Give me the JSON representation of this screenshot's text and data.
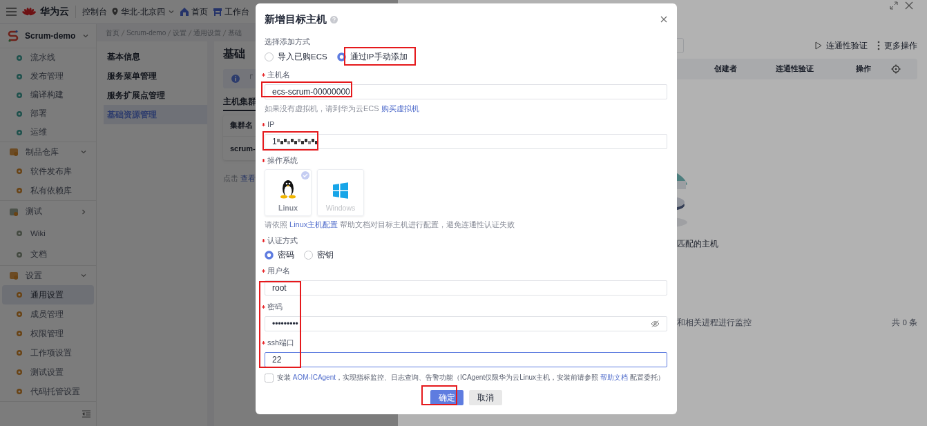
{
  "topbar": {
    "brand": "华为云",
    "console": "控制台",
    "region": "华北-北京四",
    "links": [
      {
        "label": "首页",
        "kind": "home"
      },
      {
        "label": "工作台",
        "kind": "desk"
      }
    ]
  },
  "project": {
    "name": "Scrum-demo",
    "expanded": true
  },
  "sidebar": {
    "sections": [
      {
        "items": [
          {
            "label": "流水线",
            "selected": false
          },
          {
            "label": "发布管理",
            "selected": false
          },
          {
            "label": "编译构建",
            "selected": false
          },
          {
            "label": "部署",
            "selected": false
          },
          {
            "label": "运维",
            "selected": false
          }
        ]
      },
      {
        "items": [
          {
            "label": "制品仓库",
            "selected": false,
            "expanded": true,
            "children": [
              {
                "label": "软件发布库",
                "selected": false
              },
              {
                "label": "私有依赖库",
                "selected": false
              }
            ]
          }
        ]
      },
      {
        "items": [
          {
            "label": "测试",
            "selected": false,
            "expanded": false
          },
          {
            "label": "Wiki",
            "selected": false
          },
          {
            "label": "文档",
            "selected": false
          }
        ]
      },
      {
        "items": [
          {
            "label": "设置",
            "selected": false,
            "expanded": true,
            "children": [
              {
                "label": "通用设置",
                "selected": true
              },
              {
                "label": "成员管理",
                "selected": false
              },
              {
                "label": "权限管理",
                "selected": false
              },
              {
                "label": "工作项设置",
                "selected": false
              },
              {
                "label": "测试设置",
                "selected": false
              },
              {
                "label": "代码托管设置",
                "selected": false
              }
            ]
          }
        ]
      }
    ]
  },
  "breadcrumb": [
    "首页",
    "Scrum-demo",
    "设置",
    "通用设置",
    "基础"
  ],
  "subnav": {
    "items": [
      {
        "label": "基本信息",
        "selected": false
      },
      {
        "label": "服务菜单管理",
        "selected": false
      },
      {
        "label": "服务扩展点管理",
        "selected": false
      },
      {
        "label": "基础资源管理",
        "selected": true
      }
    ]
  },
  "content": {
    "title": "基础",
    "banner": "「",
    "tabs": [
      {
        "label": "主机集群",
        "selected": true
      }
    ],
    "table": {
      "columns": [
        "集群名"
      ],
      "rows": [
        [
          "scrum-"
        ]
      ]
    },
    "hint": {
      "text": "点击",
      "link": "查看"
    }
  },
  "drawer": {
    "actions": [
      {
        "label": "连通性验证",
        "kind": "play"
      },
      {
        "label": "更多操作",
        "kind": "more"
      }
    ],
    "table": {
      "columns": [
        "创建者",
        "连通性验证",
        "操作"
      ]
    },
    "empty_text": "匹配的主机",
    "footer_text": "和相关进程进行监控",
    "total": "共 0 条"
  },
  "modal": {
    "title": "新增目标主机",
    "add_method": {
      "label": "选择添加方式",
      "options": [
        {
          "label": "导入已购ECS",
          "selected": false,
          "highlighted": false
        },
        {
          "label": "通过IP手动添加",
          "selected": true,
          "highlighted": true
        }
      ]
    },
    "fields": [
      {
        "kind": "text",
        "label": "主机名",
        "required": true,
        "value": "ecs-scrum-00000000",
        "highlighted": true,
        "help": [
          {
            "text": "如果没有虚拟机，请到华为云ECS "
          },
          {
            "link": "购买虚拟机"
          }
        ]
      },
      {
        "kind": "masked",
        "label": "IP",
        "required": true,
        "value": "1",
        "highlighted": true
      },
      {
        "kind": "os",
        "label": "操作系统",
        "required": true,
        "options": [
          {
            "label": "Linux",
            "selected": true
          },
          {
            "label": "Windows",
            "selected": false
          }
        ],
        "help": [
          {
            "text": "请依照 "
          },
          {
            "link": "Linux主机配置"
          },
          {
            "text": " 帮助文档对目标主机进行配置，避免连通性认证失败"
          }
        ]
      },
      {
        "kind": "radio",
        "label": "认证方式",
        "required": true,
        "options": [
          {
            "label": "密码",
            "selected": true
          },
          {
            "label": "密钥",
            "selected": false
          }
        ]
      },
      {
        "kind": "group",
        "highlighted": true,
        "children": [
          {
            "kind": "text",
            "label": "用户名",
            "required": true,
            "value": "root"
          },
          {
            "kind": "password",
            "label": "密码",
            "required": true,
            "value": "•••••••••"
          },
          {
            "kind": "text",
            "label": "ssh端口",
            "required": true,
            "value": "22",
            "focused": true
          }
        ]
      }
    ],
    "agent": {
      "checked": false,
      "parts": [
        {
          "text": "安装 "
        },
        {
          "link": "AOM-ICAgent"
        },
        {
          "text": "，实现指标监控、日志查询、告警功能（ICAgent仅限华为云Linux主机，安装前请参照 "
        },
        {
          "link": "帮助文档"
        },
        {
          "text": " 配置委托）"
        }
      ]
    },
    "buttons": [
      {
        "label": "确定",
        "kind": "primary",
        "highlighted": true
      },
      {
        "label": "取消",
        "kind": "secondary",
        "highlighted": false
      }
    ]
  }
}
